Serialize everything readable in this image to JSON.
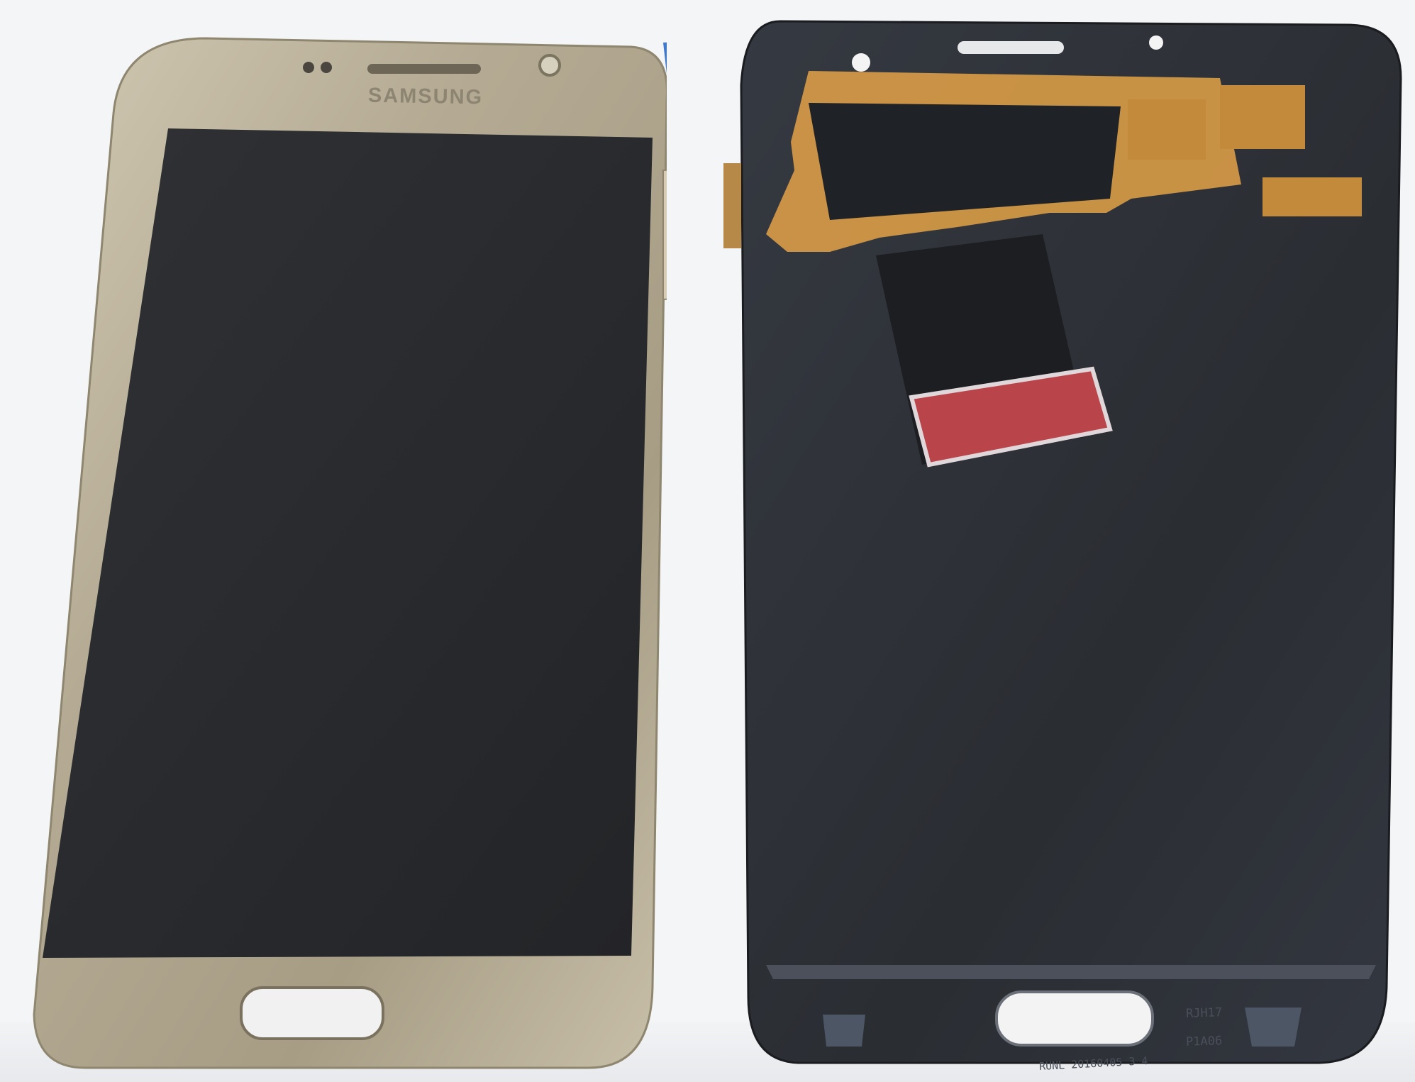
{
  "front": {
    "brand": "SAMSUNG"
  },
  "back": {
    "codes": [
      "RJH17",
      "P1A06",
      "RUNL 20160405 3 4"
    ]
  },
  "colors": {
    "gold_frame": "#b3aa93",
    "screen": "#2b2d30",
    "back_plate": "#2c2f34",
    "flex_cable": "#d69a46",
    "red_tab": "#b9454b"
  }
}
